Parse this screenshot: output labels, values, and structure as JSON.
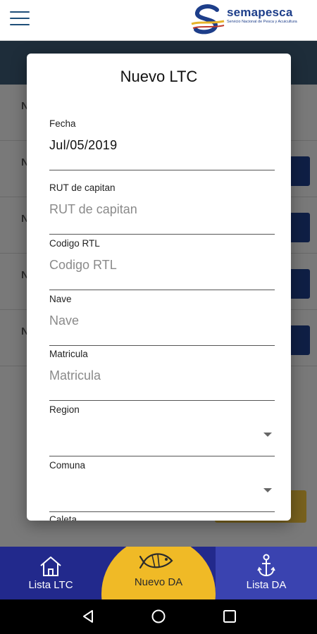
{
  "app_bar": {
    "logo": {
      "name": "semapesca",
      "subtitle": "Servicio Nacional de Pesca y Acuicultura"
    }
  },
  "dialog": {
    "title": "Nuevo LTC",
    "fields": [
      {
        "label": "Fecha",
        "value": "Jul/05/2019"
      },
      {
        "label": "RUT de capitan",
        "placeholder": "RUT de capitan"
      },
      {
        "label": "Codigo RTL",
        "placeholder": "Codigo RTL"
      },
      {
        "label": "Nave",
        "placeholder": "Nave"
      },
      {
        "label": "Matricula",
        "placeholder": "Matricula"
      },
      {
        "label": "Region",
        "value": ""
      },
      {
        "label": "Comuna",
        "value": ""
      },
      {
        "label": "Caleta"
      }
    ]
  },
  "bottom_nav": {
    "items": [
      {
        "label": "Lista LTC",
        "icon": "home-icon"
      },
      {
        "label": "Nuevo DA",
        "icon": "fish-icon"
      },
      {
        "label": "Lista DA",
        "icon": "anchor-icon"
      }
    ]
  },
  "colors": {
    "nav_blue": "#22298c",
    "nav_blue_light": "#3a43b0",
    "accent_yellow": "#f0ba26",
    "brand_blue": "#1d3e8a"
  }
}
